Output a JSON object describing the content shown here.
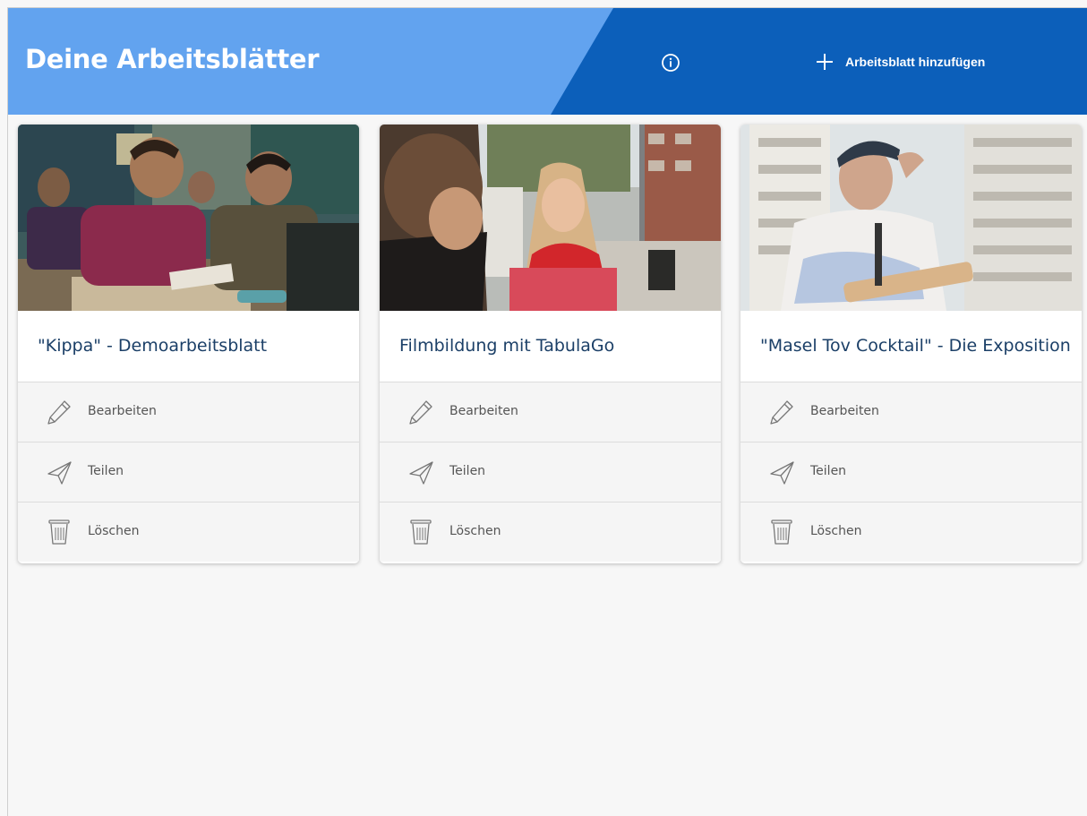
{
  "header": {
    "title": "Deine Arbeitsblätter",
    "add_label": "Arbeitsblatt hinzufügen",
    "icons": [
      "info-icon",
      "plus-icon"
    ]
  },
  "colors": {
    "header_light": "#62a3ef",
    "header_dark": "#0c5fba",
    "title_text": "#1b3f67",
    "action_bg": "#f5f5f5"
  },
  "cards": [
    {
      "title": "\"Kippa\" - Demoarbeitsblatt",
      "actions": {
        "edit": "Bearbeiten",
        "share": "Teilen",
        "delete": "Löschen"
      }
    },
    {
      "title": "Filmbildung mit TabulaGo",
      "actions": {
        "edit": "Bearbeiten",
        "share": "Teilen",
        "delete": "Löschen"
      }
    },
    {
      "title": "\"Masel Tov Cocktail\" - Die Exposition",
      "actions": {
        "edit": "Bearbeiten",
        "share": "Teilen",
        "delete": "Löschen"
      }
    }
  ]
}
